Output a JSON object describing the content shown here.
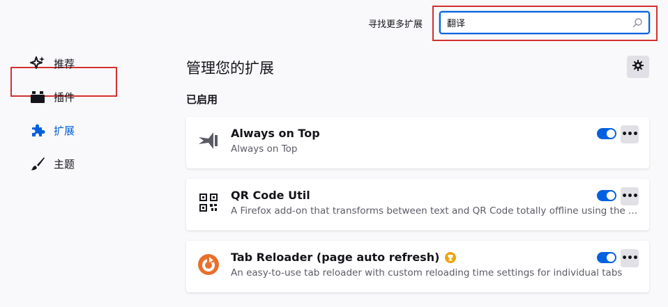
{
  "header": {
    "find_more_label": "寻找更多扩展",
    "search_value": "翻译"
  },
  "sidebar": {
    "items": [
      {
        "label": "推荐",
        "icon": "sparkle-icon"
      },
      {
        "label": "插件",
        "icon": "plugin-icon"
      },
      {
        "label": "扩展",
        "icon": "puzzle-icon",
        "active": true
      },
      {
        "label": "主题",
        "icon": "brush-icon"
      }
    ]
  },
  "main": {
    "title": "管理您的扩展",
    "section_enabled": "已启用",
    "addons": [
      {
        "name": "Always on Top",
        "description": "Always on Top",
        "enabled": true,
        "icon": "pin-window-icon"
      },
      {
        "name": "QR Code Util",
        "description": "A Firefox add-on that transforms between text and QR Code totally offline using the ...",
        "enabled": true,
        "icon": "qr-code-icon"
      },
      {
        "name": "Tab Reloader (page auto refresh)",
        "description": "An easy-to-use tab reloader with custom reloading time settings for individual tabs",
        "enabled": true,
        "icon": "reload-icon",
        "recommended": true
      }
    ],
    "more_label": "•••"
  },
  "colors": {
    "accent": "#0061e0",
    "highlight_border": "#d32f2f",
    "background": "#f9f9fb",
    "reloader_orange": "#e8702a",
    "badge_gold": "#f0a30a"
  }
}
